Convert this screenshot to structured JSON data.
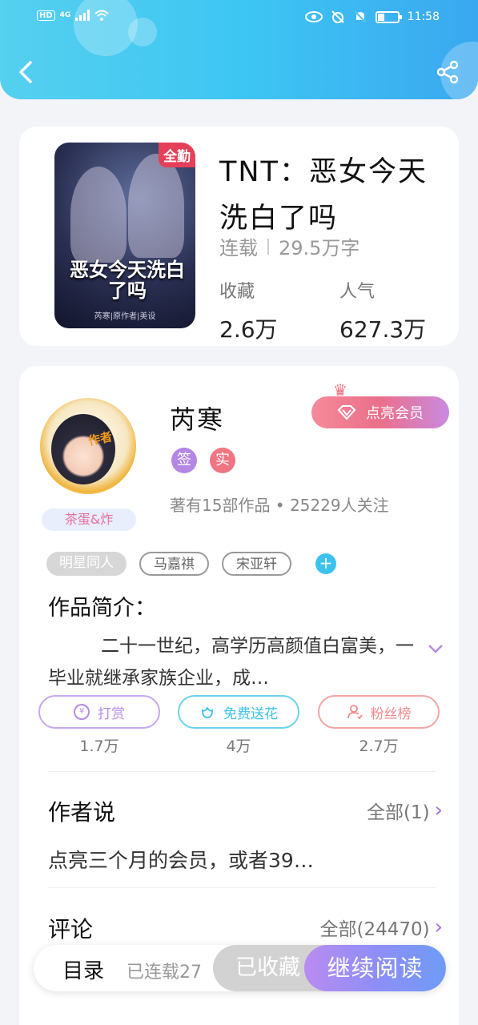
{
  "status_bar": {
    "network": "HD",
    "signal_type": "4G",
    "time": "11:58"
  },
  "header": {
    "back_icon": "chevron-left-icon",
    "share_icon": "share-icon"
  },
  "book": {
    "cover_badge": "全勤",
    "cover_title": "恶女今天洗白了吗",
    "cover_subtitle": "芮寒|原作者|美设",
    "title": "TNT：恶女今天洗白了吗",
    "status": "连载",
    "word_count": "29.5万字",
    "favorites_label": "收藏",
    "favorites_value": "2.6万",
    "popularity_label": "人气",
    "popularity_value": "627.3万"
  },
  "author": {
    "avatar_tag": "作者",
    "nickname_badge": "茶蛋&炸",
    "name": "芮寒",
    "vip_button": "点亮会员",
    "badge_sign": "签",
    "badge_real": "实",
    "meta": "著有15部作品 • 25229人关注"
  },
  "tags": [
    "明星同人",
    "马嘉祺",
    "宋亚轩"
  ],
  "intro": {
    "heading": "作品简介：",
    "text": "二十一世纪，高学历高颜值白富美，一毕业就继承家族企业，成…"
  },
  "actions": [
    {
      "label": "打赏",
      "icon": "yen-icon",
      "count": "1.7万",
      "color": "#b58be6"
    },
    {
      "label": "免费送花",
      "icon": "flower-icon",
      "count": "4万",
      "color": "#3cc2e8"
    },
    {
      "label": "粉丝榜",
      "icon": "fans-icon",
      "count": "2.7万",
      "color": "#ef8b8b"
    }
  ],
  "author_says": {
    "title": "作者说",
    "more": "全部(1)",
    "text": "点亮三个月的会员，或者39…"
  },
  "comments": {
    "title": "评论",
    "more": "全部(24470)"
  },
  "bottom_bar": {
    "catalog": "目录",
    "chapters": "已连载27",
    "collected": "已收藏",
    "continue": "继续阅读"
  }
}
